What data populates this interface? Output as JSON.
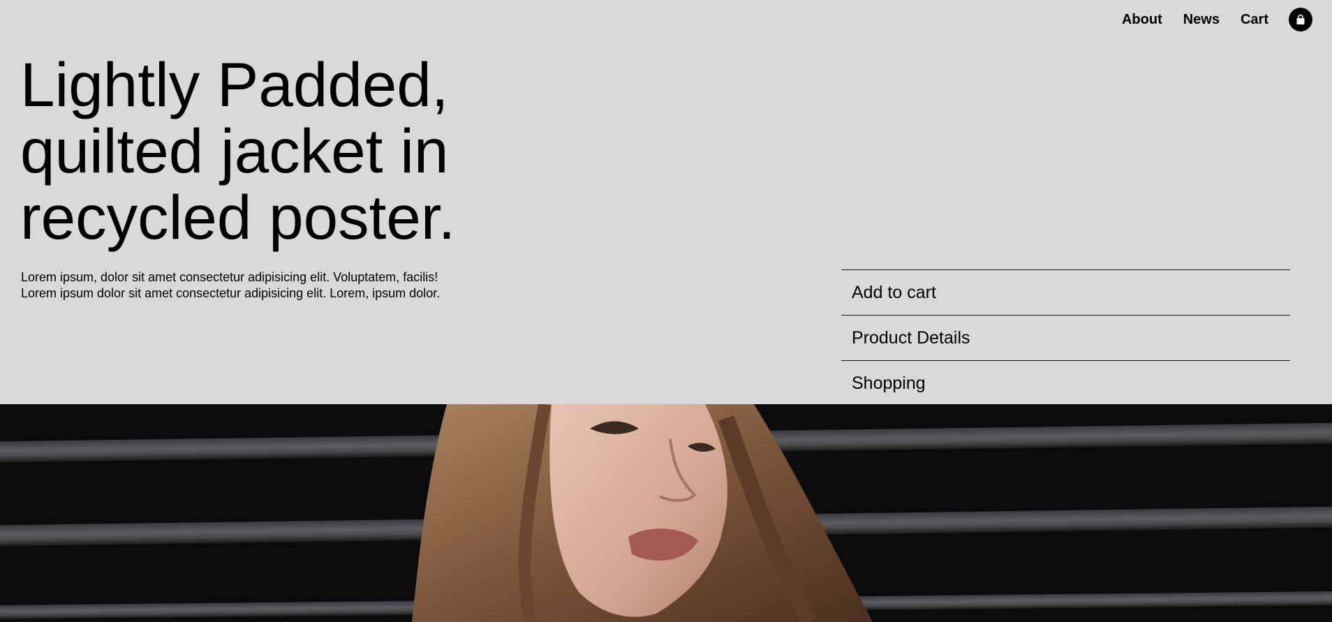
{
  "nav": {
    "links": [
      "About",
      "News",
      "Cart"
    ],
    "cart_icon": "shopping-bag-icon"
  },
  "hero": {
    "headline_lines": [
      "Lightly Padded,",
      "quilted jacket in",
      "recycled poster."
    ],
    "intro": "Lorem ipsum, dolor sit amet consectetur adipisicing elit. Voluptatem, facilis! Lorem ipsum dolor sit amet consectetur adipisicing elit. Lorem, ipsum dolor."
  },
  "actions": [
    "Add to cart",
    "Product Details",
    "Shopping"
  ],
  "photo": {
    "subject": "model-portrait-image"
  },
  "colors": {
    "background": "#d9d9d9",
    "text": "#000000",
    "photo_background": "#0b0b0d"
  }
}
